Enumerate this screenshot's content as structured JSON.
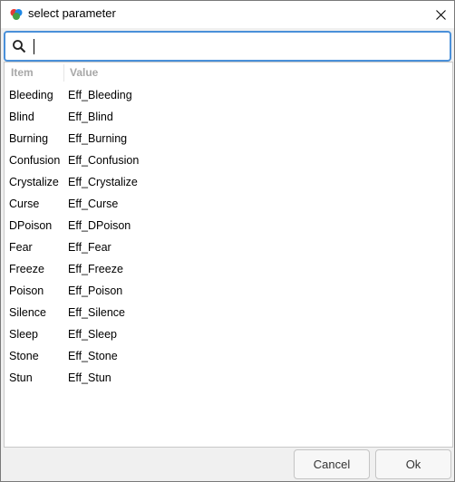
{
  "window": {
    "title": "select parameter"
  },
  "search": {
    "value": "",
    "placeholder": ""
  },
  "table": {
    "columns": [
      "Item",
      "Value"
    ],
    "rows": [
      {
        "item": "Bleeding",
        "value": "Eff_Bleeding"
      },
      {
        "item": "Blind",
        "value": "Eff_Blind"
      },
      {
        "item": "Burning",
        "value": "Eff_Burning"
      },
      {
        "item": "Confusion",
        "value": "Eff_Confusion"
      },
      {
        "item": "Crystalize",
        "value": "Eff_Crystalize"
      },
      {
        "item": "Curse",
        "value": "Eff_Curse"
      },
      {
        "item": "DPoison",
        "value": "Eff_DPoison"
      },
      {
        "item": "Fear",
        "value": "Eff_Fear"
      },
      {
        "item": "Freeze",
        "value": "Eff_Freeze"
      },
      {
        "item": "Poison",
        "value": "Eff_Poison"
      },
      {
        "item": "Silence",
        "value": "Eff_Silence"
      },
      {
        "item": "Sleep",
        "value": "Eff_Sleep"
      },
      {
        "item": "Stone",
        "value": "Eff_Stone"
      },
      {
        "item": "Stun",
        "value": "Eff_Stun"
      }
    ]
  },
  "buttons": {
    "cancel": "Cancel",
    "ok": "Ok"
  },
  "colors": {
    "search_border": "#4a90d9",
    "header_text": "#a8a8a8"
  }
}
